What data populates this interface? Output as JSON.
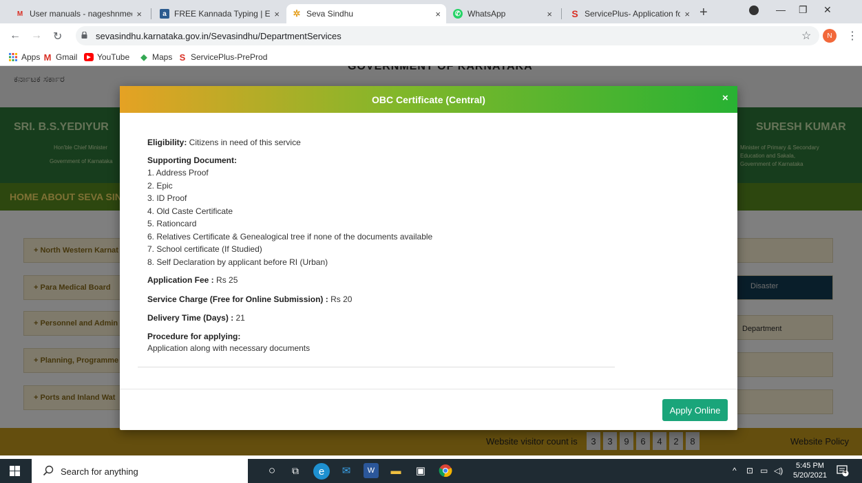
{
  "browser": {
    "tabs": [
      {
        "title": "User manuals - nageshnmedc",
        "favicon": "gmail-icon",
        "active": false
      },
      {
        "title": "FREE Kannada Typing | Englis",
        "favicon": "typing-site-icon",
        "active": false
      },
      {
        "title": "Seva Sindhu",
        "favicon": "seva-sindhu-icon",
        "active": true
      },
      {
        "title": "WhatsApp",
        "favicon": "whatsapp-icon",
        "active": false
      },
      {
        "title": "ServicePlus- Application for C",
        "favicon": "serviceplus-icon",
        "active": false
      }
    ],
    "url": "sevasindhu.karnataka.gov.in/Sevasindhu/DepartmentServices",
    "profile_initial": "N",
    "bookmarks": [
      {
        "label": "Apps",
        "icon": "apps-grid-icon"
      },
      {
        "label": "Gmail",
        "icon": "gmail-icon"
      },
      {
        "label": "YouTube",
        "icon": "youtube-icon"
      },
      {
        "label": "Maps",
        "icon": "maps-icon"
      },
      {
        "label": "ServicePlus-PreProd",
        "icon": "serviceplus-icon"
      }
    ]
  },
  "background_page": {
    "kannada_header": "ಕರ್ನಾಟಕ ಸರ್ಕಾರ",
    "gov_title": "GOVERNMENT OF KARNATAKA",
    "banner_left": "SRI. B.S.YEDIYUR",
    "banner_right": "SURESH KUMAR",
    "banner_left_sub": [
      "Hon'ble Chief Minister",
      "Government of Karnataka"
    ],
    "banner_right_sub": [
      "Minister of Primary & Secondary",
      "Education and Sakala,",
      "Government of Karnataka"
    ],
    "menu": "HOME  ABOUT SEVA SIND",
    "left_cards": [
      "+ North Western Karnat",
      "+ Para Medical Board",
      "+ Personnel and Admin",
      "+ Planning, Programme",
      "+ Ports and Inland Wat"
    ],
    "right_texts": [
      "Disaster",
      "Department"
    ],
    "visitor_label": "Website visitor count is",
    "visitor_digits": [
      "3",
      "3",
      "9",
      "6",
      "4",
      "2",
      "8"
    ],
    "policy": "Website Policy"
  },
  "modal": {
    "title": "OBC Certificate (Central)",
    "close_label": "×",
    "eligibility_label": "Eligibility:",
    "eligibility_value": " Citizens in need of this service",
    "supporting_label": "Supporting Document:",
    "documents": [
      "1.  Address Proof",
      "2.  Epic",
      "3.  ID Proof",
      "4.  Old Caste Certificate",
      "5.  Rationcard",
      "6.  Relatives Certificate & Genealogical tree if none of the documents available",
      "7.  School certificate (If Studied)",
      "8.  Self Declaration by applicant before RI (Urban)"
    ],
    "fee_label": "Application Fee :",
    "fee_value": " Rs 25",
    "service_label": "Service Charge (Free for Online Submission) :",
    "service_value": " Rs 20",
    "delivery_label": "Delivery Time (Days) :",
    "delivery_value": " 21",
    "procedure_label": "Procedure for applying:",
    "procedure_value": "Application along with necessary documents",
    "apply_button": "Apply Online"
  },
  "taskbar": {
    "search_placeholder": "Search for anything",
    "time": "5:45 PM",
    "date": "5/20/2021",
    "notification_count": "4"
  }
}
